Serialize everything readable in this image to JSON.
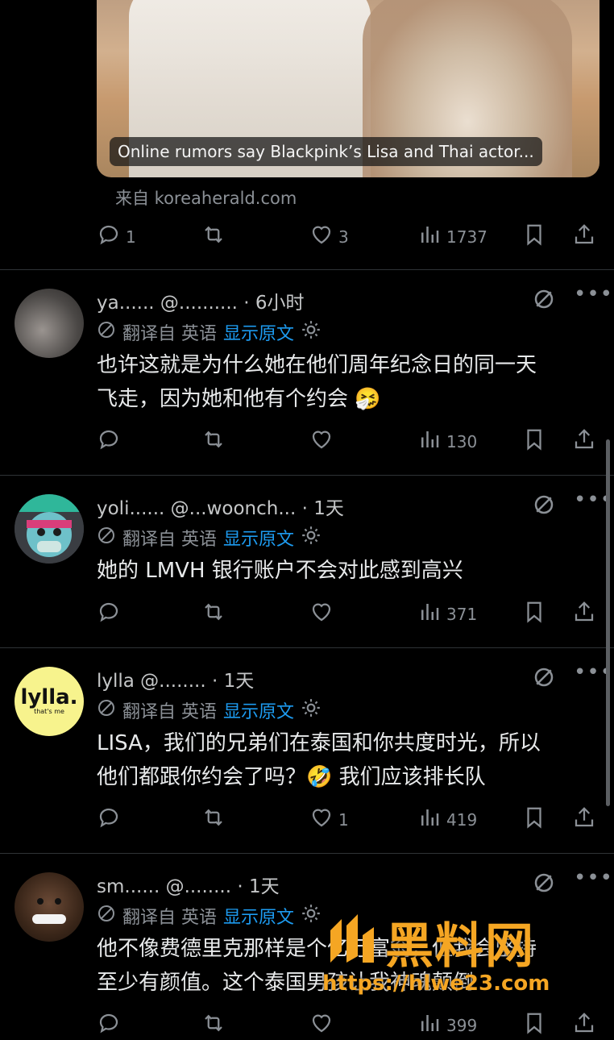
{
  "card": {
    "caption": "Online rumors say Blackpink’s Lisa and Thai actor...",
    "source": "来自 koreaherald.com",
    "replies": "1",
    "likes": "3",
    "views": "1737"
  },
  "translate": {
    "label": "翻译自 英语",
    "show_original": "显示原文"
  },
  "replies": [
    {
      "name": "ya...... @.......... · 6小时",
      "text_lines": [
        "也许这就是为什么她在他们周年纪念日的同一天",
        "飞走，因为她和他有个约会 🤧"
      ],
      "reply_count": "",
      "like_count": "",
      "views": "130"
    },
    {
      "name": "yoli...... @...woonch... · 1天",
      "text_lines": [
        "她的 LMVH 银行账户不会对此感到高兴"
      ],
      "reply_count": "",
      "like_count": "",
      "views": "371"
    },
    {
      "name": "lylla @........ · 1天",
      "text_lines": [
        "LISA，我们的兄弟们在泰国和你共度时光，所以",
        "他们都跟你约会了吗？🤣 我们应该排长队"
      ],
      "reply_count": "",
      "like_count": "1",
      "views": "419"
    },
    {
      "name": "sm...... @........ · 1天",
      "text_lines": [
        "他不像费德里克那样是个亿万富翁，但我会坚持",
        "至少有颜值。这个泰国男孩让我神魂颠倒"
      ],
      "reply_count": "",
      "like_count": "",
      "views": "399"
    }
  ],
  "avatars": {
    "lylla_text": "lylla.",
    "lylla_sub": "that's me"
  },
  "watermark": {
    "title": "黑料网",
    "url": "https://hlwe23.com"
  },
  "colors": {
    "accent": "#1d9bf0",
    "muted": "#8b9096",
    "watermark": "#f5a623"
  }
}
